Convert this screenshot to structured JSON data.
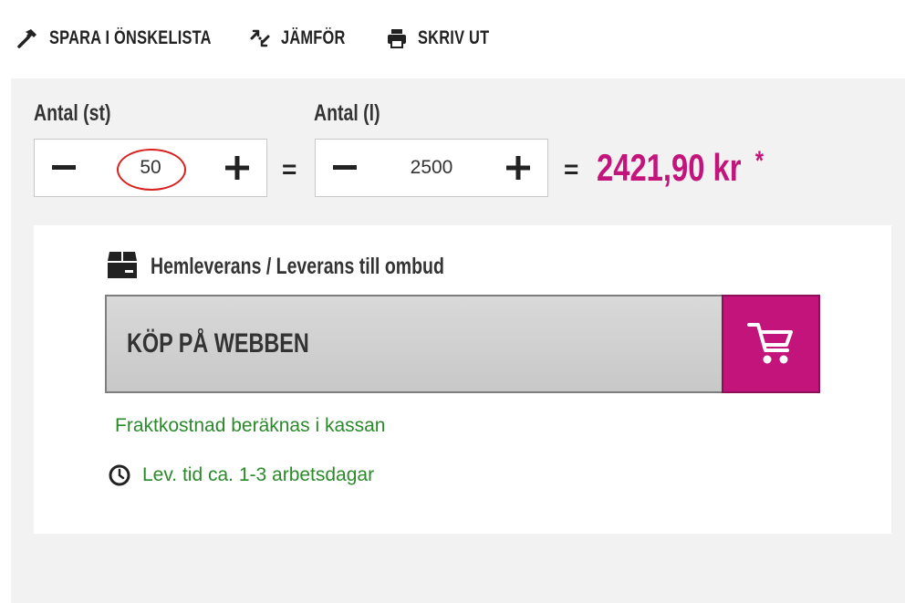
{
  "actions": {
    "wishlist_label": "SPARA I ÖNSKELISTA",
    "compare_label": "JÄMFÖR",
    "print_label": "SKRIV UT"
  },
  "quantity_units": {
    "label": "Antal (st)",
    "value": "50",
    "minus": "−",
    "plus": "+"
  },
  "quantity_liters": {
    "label": "Antal (l)",
    "value": "2500",
    "minus": "−",
    "plus": "+"
  },
  "equals": "=",
  "price": {
    "amount": "2421,90 kr",
    "asterisk": "*",
    "color": "#c2147b"
  },
  "delivery": {
    "title": "Hemleverans / Leverans till ombud",
    "icon": "package-box-icon"
  },
  "buy_button": {
    "label": "KÖP PÅ WEBBEN",
    "icon": "shopping-cart-icon"
  },
  "freight_note": "Fraktkostnad beräknas i kassan",
  "lead_time": {
    "text": "Lev. tid ca. 1-3 arbetsdagar",
    "icon": "clock-icon"
  }
}
